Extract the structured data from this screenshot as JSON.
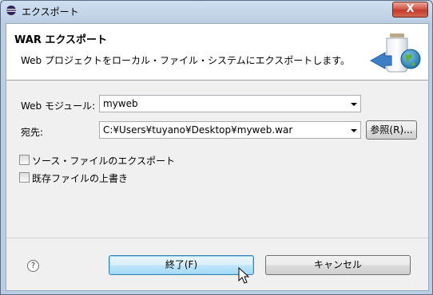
{
  "window": {
    "title": "エクスポート",
    "close_label": "X"
  },
  "banner": {
    "title": "WAR エクスポート",
    "description": "Web プロジェクトをローカル・ファイル・システムにエクスポートします。"
  },
  "form": {
    "web_module": {
      "label": "Web モジュール:",
      "value": "myweb"
    },
    "destination": {
      "label": "宛先:",
      "value": "C:¥Users¥tuyano¥Desktop¥myweb.war"
    },
    "browse_label": "参照(R)..."
  },
  "options": {
    "export_source": {
      "label": "ソース・ファイルのエクスポート",
      "checked": false
    },
    "overwrite": {
      "label": "既存ファイルの上書き",
      "checked": false
    }
  },
  "buttons": {
    "help_label": "?",
    "finish_label": "終了(F)",
    "cancel_label": "キャンセル"
  },
  "colors": {
    "accent": "#3c7fb1",
    "close": "#c23a2b"
  }
}
